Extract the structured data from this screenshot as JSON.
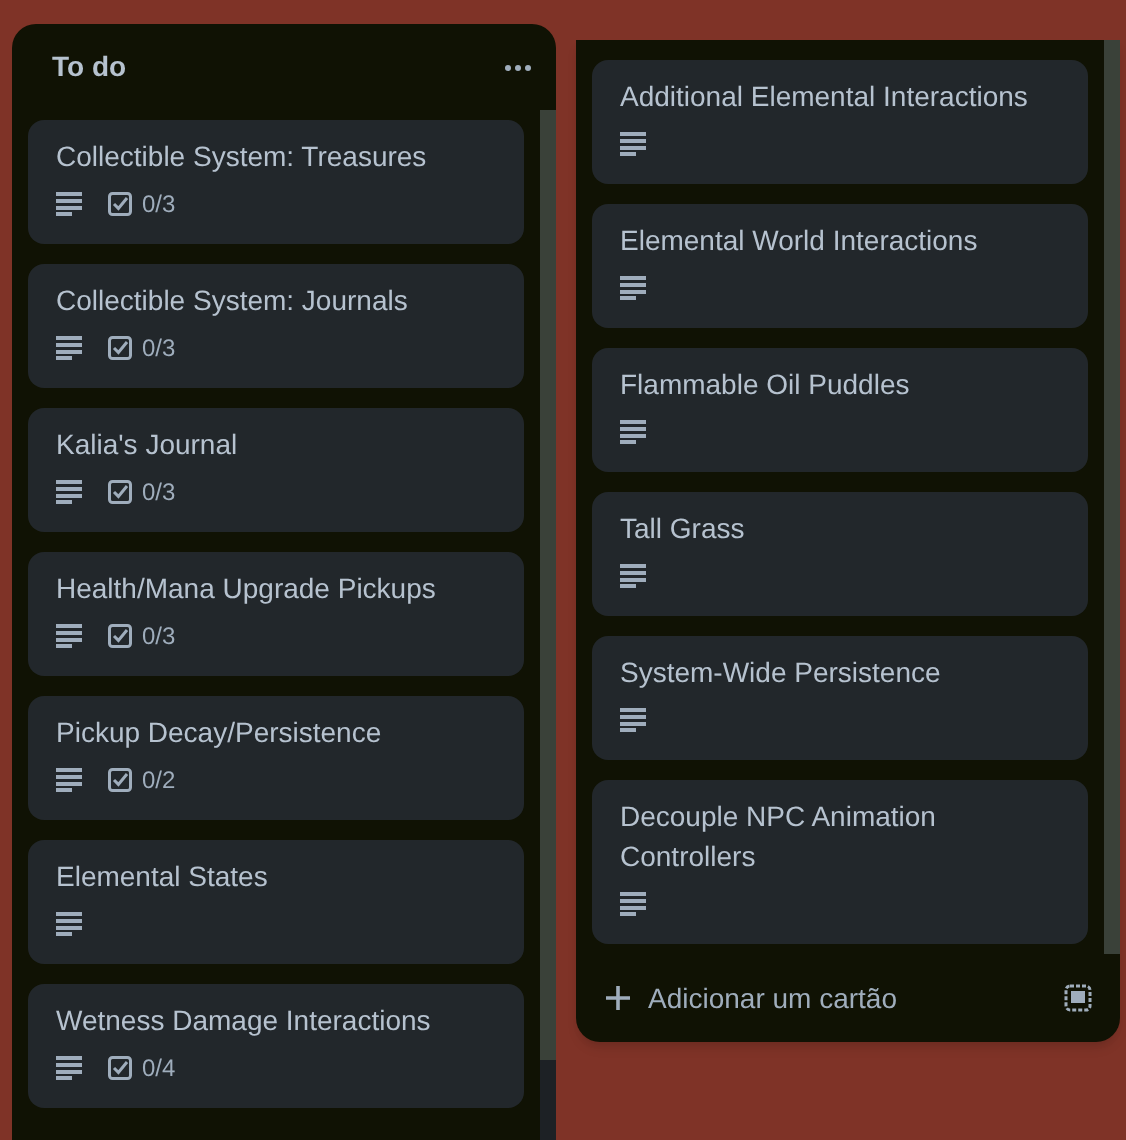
{
  "lists": [
    {
      "title": "To do",
      "cards": [
        {
          "title": "Collectible System: Treasures",
          "checklist": "0/3"
        },
        {
          "title": "Collectible System: Journals",
          "checklist": "0/3"
        },
        {
          "title": "Kalia's Journal",
          "checklist": "0/3"
        },
        {
          "title": "Health/Mana Upgrade Pickups",
          "checklist": "0/3"
        },
        {
          "title": "Pickup Decay/Persistence",
          "checklist": "0/2"
        },
        {
          "title": "Elemental States"
        },
        {
          "title": "Wetness Damage Interactions",
          "checklist": "0/4"
        }
      ]
    },
    {
      "cards": [
        {
          "title": "Additional Elemental Interactions"
        },
        {
          "title": "Elemental World Interactions"
        },
        {
          "title": "Flammable Oil Puddles"
        },
        {
          "title": "Tall Grass"
        },
        {
          "title": "System-Wide Persistence"
        },
        {
          "title": "Decouple NPC Animation Controllers"
        }
      ],
      "add_card": "Adicionar um cartão"
    }
  ]
}
